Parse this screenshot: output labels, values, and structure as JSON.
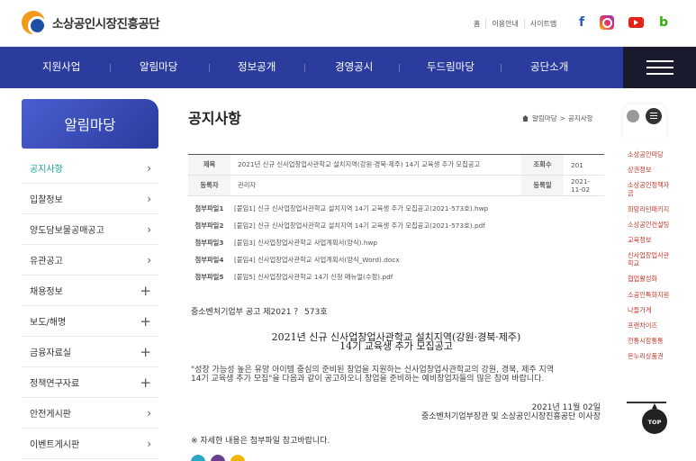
{
  "header": {
    "logo_text": "소상공인시장진흥공단",
    "util_links": [
      "홈",
      "이용안내",
      "사이트맵"
    ],
    "sns": [
      "facebook-icon",
      "instagram-icon",
      "youtube-icon",
      "blog-icon"
    ],
    "sns_glyphs": {
      "facebook": "f",
      "blog": "b"
    }
  },
  "gnb": {
    "items": [
      "지원사업",
      "알림마당",
      "정보공개",
      "경영공시",
      "두드림마당",
      "공단소개"
    ]
  },
  "sidebar": {
    "title": "알림마당",
    "items": [
      {
        "label": "공지사항",
        "active": true,
        "toggle": "›"
      },
      {
        "label": "입찰정보",
        "toggle": "›"
      },
      {
        "label": "양도담보물공매공고",
        "toggle": "›"
      },
      {
        "label": "유관공고",
        "toggle": "›"
      },
      {
        "label": "채용정보",
        "toggle": "+"
      },
      {
        "label": "보도/해명",
        "toggle": "+"
      },
      {
        "label": "금융자료실",
        "toggle": "+"
      },
      {
        "label": "정책연구자료",
        "toggle": "+"
      },
      {
        "label": "안전게시판",
        "toggle": "›"
      },
      {
        "label": "이벤트게시판",
        "toggle": "›"
      }
    ]
  },
  "main": {
    "page_title": "공지사항",
    "breadcrumb": [
      "알림마당",
      "공지사항"
    ],
    "breadcrumb_sep": ">",
    "detail": {
      "title_label": "제목",
      "title_value": "2021년 신규 신사업창업사관학교 설치지역(강원·경북·제주) 14기 교육생 추가 모집공고",
      "views_label": "조회수",
      "views_value": "201",
      "author_label": "등록자",
      "author_value": "관리자",
      "date_label": "등록일",
      "date_value": "2021-11-02",
      "files": [
        {
          "label": "첨부파일1",
          "name": "[붙임1] 신규 신사업창업사관학교 설치지역 14기 교육생 추가 모집공고(2021-573호).hwp"
        },
        {
          "label": "첨부파일2",
          "name": "[붙임2] 신규 신사업창업사관학교 설치지역 14기 교육생 추가 모집공고(2021-573호).pdf"
        },
        {
          "label": "첨부파일3",
          "name": "[붙임3] 신사업창업사관학교 사업계획서(양식).hwp"
        },
        {
          "label": "첨부파일4",
          "name": "[붙임4] 신사업창업사관학교 사업계획서(양식_Word).docx"
        },
        {
          "label": "첨부파일5",
          "name": "[붙임5] 신사업창업사관학교 14기 신청 매뉴얼(수정).pdf"
        }
      ]
    },
    "content": {
      "notice_no": "중소벤처기업부 공고 제2021 ？ 573호",
      "notice_title_1": "2021년 신규 신사업창업사관학교 설치지역(강원·경북·제주)",
      "notice_title_2": "14기 교육생 추가 모집공고",
      "para_1": "\"성장 가능성 높은 유망 아이템 중심의 준비된 창업을 지원하는 신사업창업사관학교의 강원, 경북, 제주 지역",
      "para_2": "14기 교육생 추가 모집\"을 다음과 같이 공고하오니 창업을 준비하는 예비창업자들의 많은 참여 바랍니다.",
      "date": "2021년 11월 02일",
      "signer": "중소벤처기업부장관 및 소상공인시장진흥공단 이사장",
      "note": "※ 자세한 내용은 첨부파일 참고바랍니다."
    }
  },
  "quick_menu": {
    "items": [
      "소상공인마당",
      "상권정보",
      "소상공인정책자금",
      "희망리턴패키지",
      "소상공인컨설팅",
      "교육정보",
      "신사업창업사관학교",
      "협업활성화",
      "소공인특화지원",
      "나들가게",
      "프랜차이즈",
      "전통시장통통",
      "온누리상품권"
    ],
    "top_label": "TOP"
  },
  "colors": {
    "gnb_bg": "#2b3b9e",
    "active_menu": "#1aa398",
    "quick_text": "#c0382b"
  }
}
